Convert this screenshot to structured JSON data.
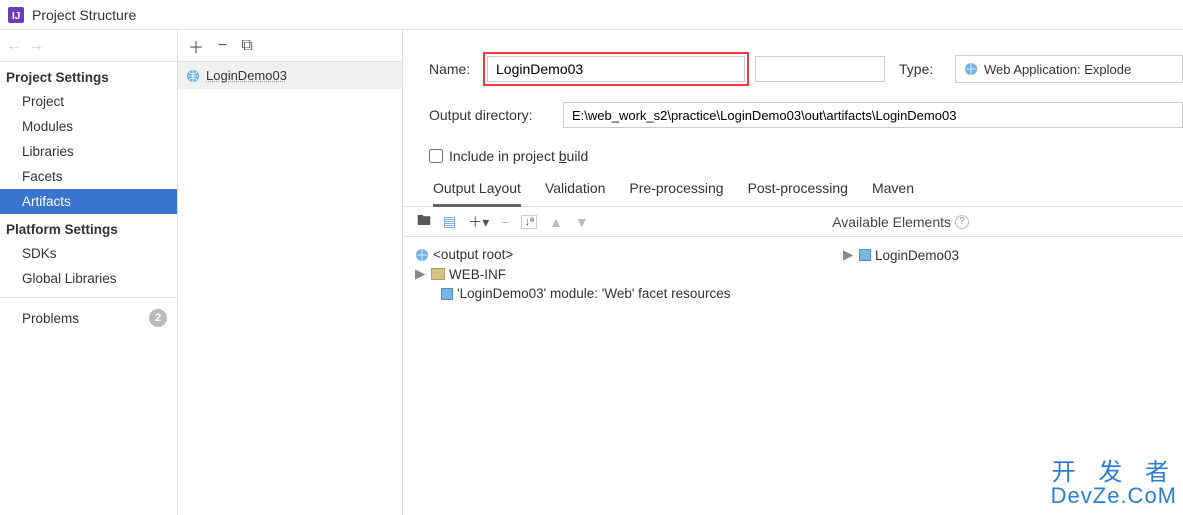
{
  "window": {
    "title": "Project Structure"
  },
  "sidebar": {
    "sections": [
      {
        "label": "Project Settings",
        "items": [
          "Project",
          "Modules",
          "Libraries",
          "Facets",
          "Artifacts"
        ]
      },
      {
        "label": "Platform Settings",
        "items": [
          "SDKs",
          "Global Libraries"
        ]
      }
    ],
    "problems": {
      "label": "Problems",
      "count": 2
    },
    "selected": "Artifacts"
  },
  "artifacts_list": [
    {
      "name": "LoginDemo03"
    }
  ],
  "form": {
    "name_label": "Name:",
    "name_value": "LoginDemo03",
    "type_label": "Type:",
    "type_value": "Web Application: Explode",
    "outdir_label": "Output directory:",
    "outdir_value": "E:\\web_work_s2\\practice\\LoginDemo03\\out\\artifacts\\LoginDemo03",
    "include_label": "Include in project build",
    "include_checked": false
  },
  "tabs": {
    "items": [
      "Output Layout",
      "Validation",
      "Pre-processing",
      "Post-processing",
      "Maven"
    ],
    "active": "Output Layout"
  },
  "available_label": "Available Elements",
  "output_tree": {
    "root": "<output root>",
    "children": [
      {
        "label": "WEB-INF",
        "kind": "folder"
      },
      {
        "label": "'LoginDemo03' module: 'Web' facet resources",
        "kind": "module"
      }
    ]
  },
  "right_tree": {
    "root": "LoginDemo03"
  },
  "watermark": {
    "line1": "开 发 者",
    "line2": "DevZe.CoM"
  }
}
